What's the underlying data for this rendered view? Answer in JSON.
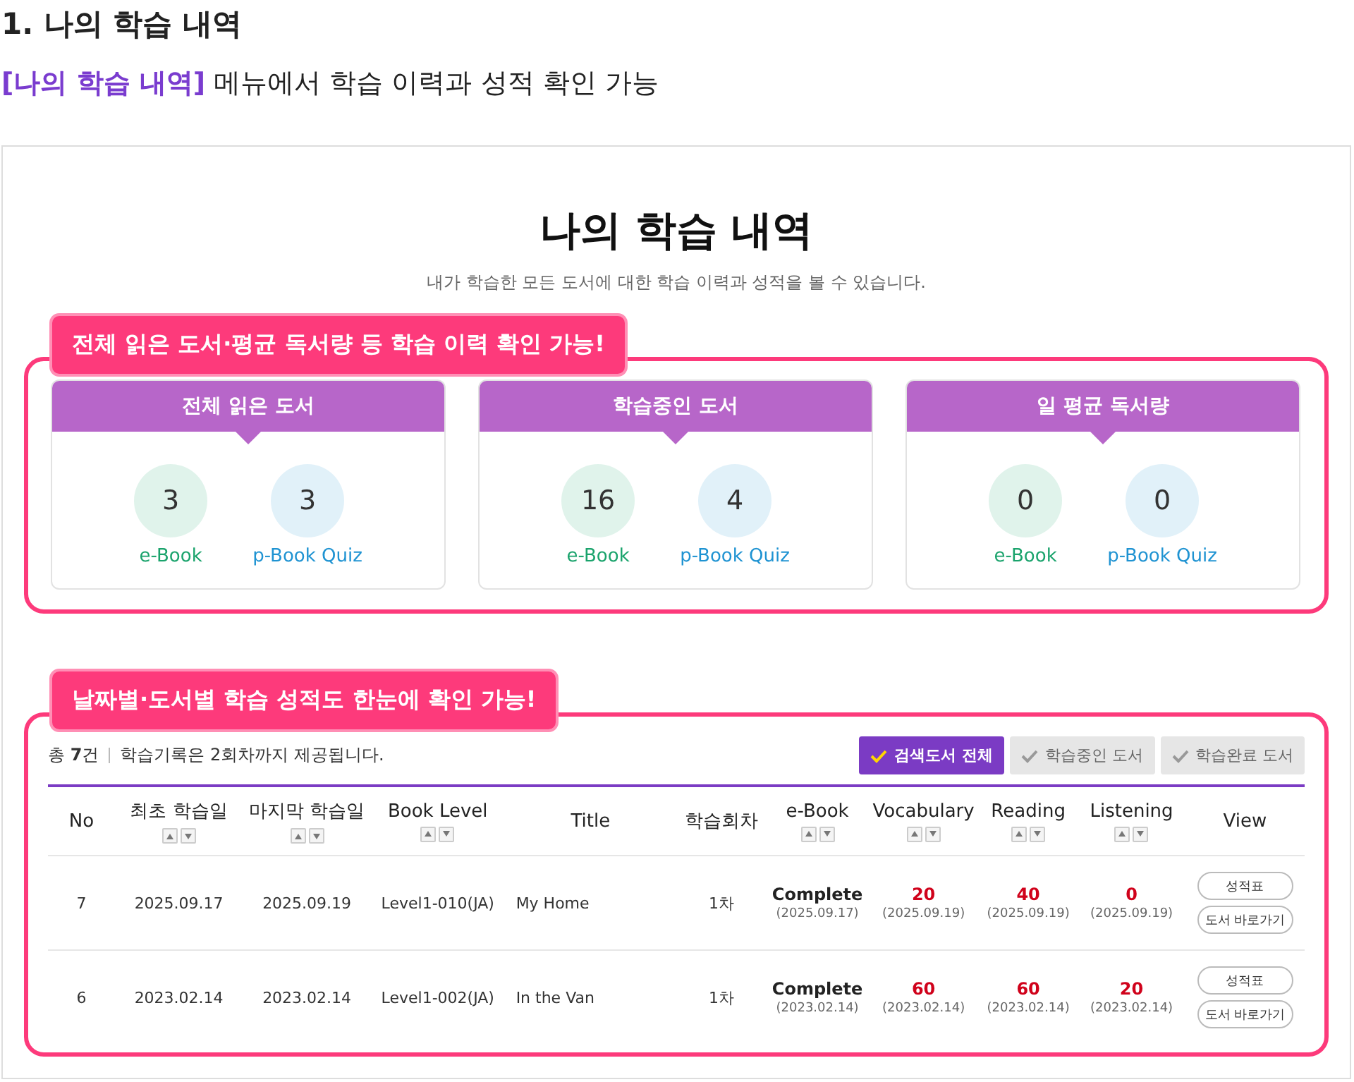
{
  "doc_heading": "1. 나의 학습 내역",
  "doc_subtitle": "**[나의 학습 내역]** 메뉴에서 학습 이력과 성적 확인 가능",
  "page": {
    "title": "나의 학습 내역",
    "description": "내가 학습한 모든 도서에 대한 학습 이력과 성적을 볼 수 있습니다."
  },
  "callouts": [
    "전체 읽은 도서·평균 독서량 등 학습 이력 확인 가능!",
    "날짜별·도서별 학습 성적도 한눈에 확인 가능!"
  ],
  "stat_cards": [
    {
      "title": "전체 읽은 도서",
      "stats": [
        {
          "value": "3",
          "label": "e-Book",
          "color": "#1aa36c"
        },
        {
          "value": "3",
          "label": "p-Book Quiz",
          "color": "#1f93d2"
        }
      ]
    },
    {
      "title": "학습중인 도서",
      "stats": [
        {
          "value": "16",
          "label": "e-Book",
          "color": "#1aa36c"
        },
        {
          "value": "4",
          "label": "p-Book Quiz",
          "color": "#1f93d2"
        }
      ]
    },
    {
      "title": "일 평균 독서량",
      "stats": [
        {
          "value": "0",
          "label": "e-Book",
          "color": "#1aa36c"
        },
        {
          "value": "0",
          "label": "p-Book Quiz",
          "color": "#1f93d2"
        }
      ]
    }
  ],
  "records": {
    "total_prefix": "총",
    "total_count": "7",
    "total_suffix": "건",
    "notice": "학습기록은 2회차까지 제공됩니다.",
    "filters": [
      {
        "label": "검색도서 전체",
        "selected": true
      },
      {
        "label": "학습중인 도서",
        "selected": false
      },
      {
        "label": "학습완료 도서",
        "selected": false
      }
    ],
    "columns": [
      {
        "label": "No",
        "sortable": false
      },
      {
        "label": "최초 학습일",
        "sortable": true
      },
      {
        "label": "마지막 학습일",
        "sortable": true
      },
      {
        "label": "Book Level",
        "sortable": true
      },
      {
        "label": "Title",
        "sortable": false
      },
      {
        "label": "학습회차",
        "sortable": false
      },
      {
        "label": "e-Book",
        "sortable": true
      },
      {
        "label": "Vocabulary",
        "sortable": true
      },
      {
        "label": "Reading",
        "sortable": true
      },
      {
        "label": "Listening",
        "sortable": true
      },
      {
        "label": "View",
        "sortable": false
      }
    ],
    "rows": [
      {
        "no": "7",
        "first": "2025.09.17",
        "last": "2025.09.19",
        "level": "Level1-010(JA)",
        "title": "My Home",
        "round": "1차",
        "results": [
          {
            "kind": "status",
            "value": "Complete",
            "date": "(2025.09.17)"
          },
          {
            "kind": "score",
            "value": "20",
            "date": "(2025.09.19)"
          },
          {
            "kind": "score",
            "value": "40",
            "date": "(2025.09.19)"
          },
          {
            "kind": "score",
            "value": "0",
            "date": "(2025.09.19)"
          }
        ],
        "buttons": [
          "성적표",
          "도서 바로가기"
        ]
      },
      {
        "no": "6",
        "first": "2023.02.14",
        "last": "2023.02.14",
        "level": "Level1-002(JA)",
        "title": "In the Van",
        "round": "1차",
        "results": [
          {
            "kind": "status",
            "value": "Complete",
            "date": "(2023.02.14)"
          },
          {
            "kind": "score",
            "value": "60",
            "date": "(2023.02.14)"
          },
          {
            "kind": "score",
            "value": "60",
            "date": "(2023.02.14)"
          },
          {
            "kind": "score",
            "value": "20",
            "date": "(2023.02.14)"
          }
        ],
        "buttons": [
          "성적표",
          "도서 바로가기"
        ]
      }
    ]
  }
}
